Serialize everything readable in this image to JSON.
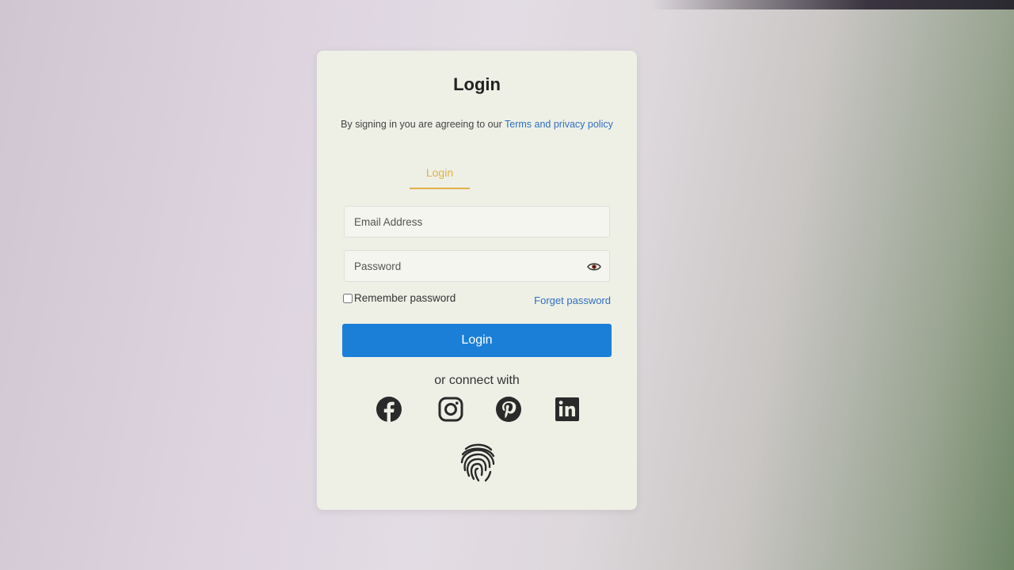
{
  "login": {
    "title": "Login",
    "terms_prefix": "By signing in you are agreeing to our ",
    "terms_link": "Terms and privacy policy",
    "tab_label": "Login",
    "email_placeholder": "Email Address",
    "password_placeholder": "Password",
    "remember_label": "Remember password",
    "forget_label": "Forget password",
    "login_button": "Login",
    "connect_label": "or connect with"
  },
  "icons": {
    "eye": "eye-icon",
    "facebook": "facebook-icon",
    "instagram": "instagram-icon",
    "pinterest": "pinterest-icon",
    "linkedin": "linkedin-icon",
    "fingerprint": "fingerprint-icon"
  },
  "colors": {
    "primary_button": "#1b7fd8",
    "link": "#2f6fbf",
    "tab_accent": "#e0b04a"
  }
}
